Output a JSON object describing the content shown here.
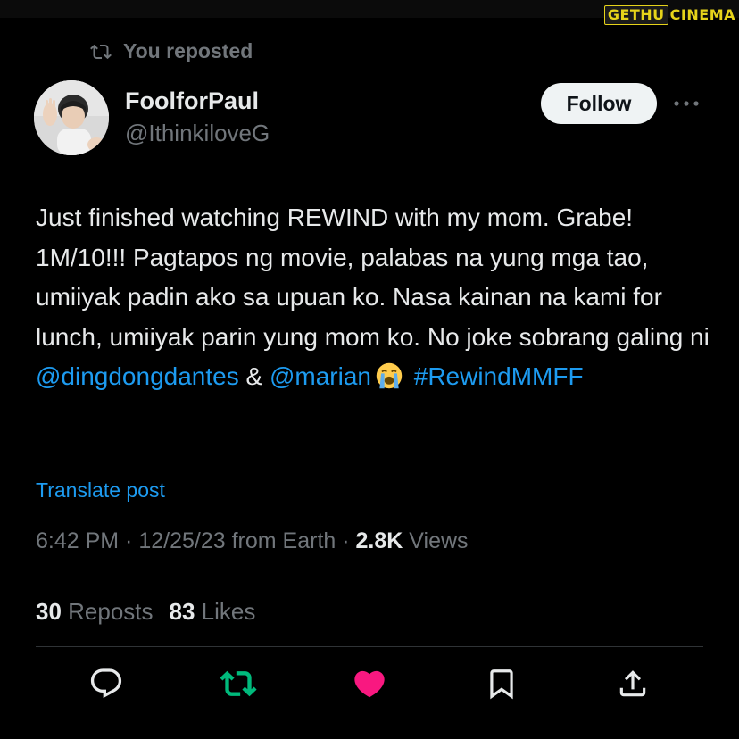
{
  "watermark": {
    "part1": "GETHU",
    "part2": "CINEMA"
  },
  "social_context": {
    "icon": "repost-icon",
    "text": "You reposted"
  },
  "author": {
    "display_name": "FoolforPaul",
    "handle": "@IthinkiloveG",
    "avatar": "profile-photo"
  },
  "follow_button": {
    "label": "Follow"
  },
  "more_menu": {
    "icon": "more-horizontal-icon"
  },
  "post": {
    "text_1": "Just finished watching REWIND with my mom. Grabe! 1M/10!!! Pagtapos ng movie, palabas na yung mga tao, umiiyak padin ako sa upuan ko. Nasa kainan na kami for lunch, umiiyak parin yung mom ko. No joke sobrang galing ni ",
    "mention_1": "@dingdongdantes",
    "text_2": " & ",
    "mention_2": "@marian",
    "emoji": "loudly-crying-face",
    "hashtag": "#RewindMMFF"
  },
  "translate_link": "Translate post",
  "meta": {
    "time": "6:42 PM",
    "separator": " · ",
    "date": "12/25/23",
    "location": " from Earth",
    "separator_2": " · ",
    "views_count": "2.8K",
    "views_label": " Views"
  },
  "stats": {
    "reposts_count": "30",
    "reposts_label": " Reposts",
    "likes_count": "83",
    "likes_label": " Likes"
  },
  "actions": [
    {
      "name": "reply",
      "icon": "reply-icon",
      "state": "default"
    },
    {
      "name": "repost",
      "icon": "repost-icon",
      "state": "active"
    },
    {
      "name": "like",
      "icon": "heart-icon",
      "state": "liked"
    },
    {
      "name": "bookmark",
      "icon": "bookmark-icon",
      "state": "default"
    },
    {
      "name": "share",
      "icon": "share-icon",
      "state": "default"
    }
  ],
  "colors": {
    "background": "#000000",
    "text_primary": "#e7e9ea",
    "text_secondary": "#71767b",
    "link": "#1d9bf0",
    "repost_active": "#00ba7c",
    "like_active": "#f91880",
    "follow_button_bg": "#eff3f4",
    "divider": "#2f3336"
  }
}
